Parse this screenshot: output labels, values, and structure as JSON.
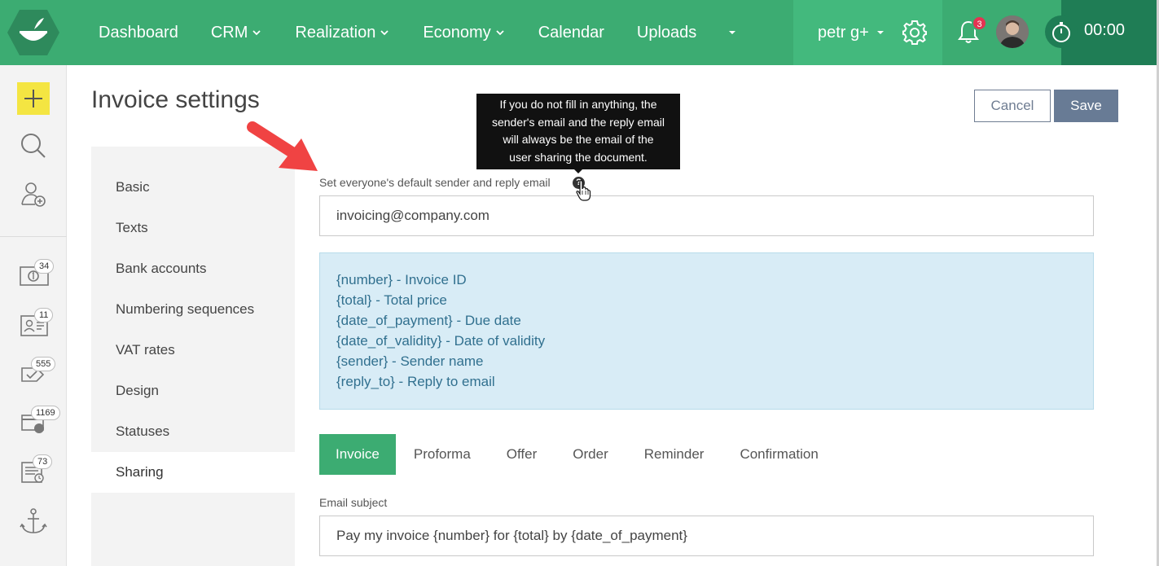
{
  "nav": {
    "items": [
      {
        "label": "Dashboard",
        "dropdown": false
      },
      {
        "label": "CRM",
        "dropdown": true
      },
      {
        "label": "Realization",
        "dropdown": true
      },
      {
        "label": "Economy",
        "dropdown": true
      },
      {
        "label": "Calendar",
        "dropdown": false
      },
      {
        "label": "Uploads",
        "dropdown": false
      }
    ],
    "user_name": "petr g+",
    "notification_count": "3",
    "timer": "00:00"
  },
  "sidebar": {
    "badges": {
      "money": "34",
      "contacts": "11",
      "tasks": "555",
      "payments": "1169",
      "timesheets": "73"
    }
  },
  "page": {
    "title": "Invoice settings",
    "cancel_label": "Cancel",
    "save_label": "Save"
  },
  "settings_nav": {
    "items": [
      "Basic",
      "Texts",
      "Bank accounts",
      "Numbering sequences",
      "VAT rates",
      "Design",
      "Statuses",
      "Sharing"
    ],
    "active": "Sharing"
  },
  "sharing": {
    "default_email_label": "Set everyone's default sender and reply email",
    "default_email_value": "invoicing@company.com",
    "tooltip_lines": [
      "If you do not fill in anything, the",
      "sender's email and the reply email",
      "will always be the email of the",
      "user sharing the document."
    ],
    "placeholders": [
      "{number} - Invoice ID",
      "{total} - Total price",
      "{date_of_payment} - Due date",
      "{date_of_validity} - Date of validity",
      "{sender} - Sender name",
      "{reply_to} - Reply to email"
    ],
    "tabs": [
      "Invoice",
      "Proforma",
      "Offer",
      "Order",
      "Reminder",
      "Confirmation"
    ],
    "active_tab": "Invoice",
    "subject_label": "Email subject",
    "subject_value": "Pay my invoice {number} for {total} by {date_of_payment}"
  },
  "colors": {
    "brand_green": "#3cac72",
    "dark_green": "#1f7d55",
    "save_blue": "#687b95",
    "info_bg": "#d8ecf6",
    "info_text": "#31708f",
    "badge_red": "#e53352",
    "add_yellow": "#f4e542",
    "annotation_arrow": "#f04343"
  }
}
